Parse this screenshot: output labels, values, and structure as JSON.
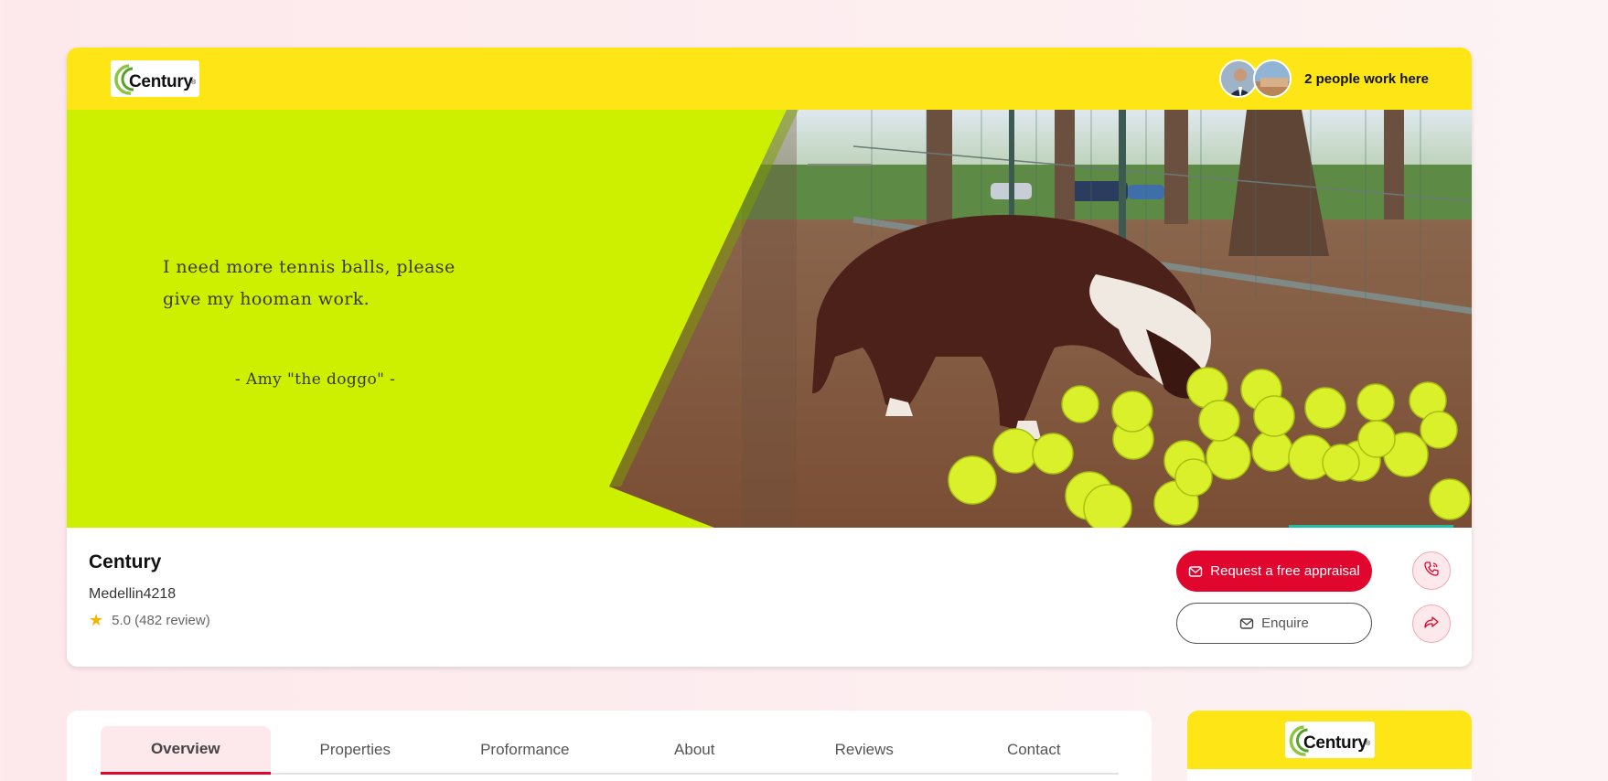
{
  "brand": {
    "name": "Century",
    "logo_text": "Century",
    "logo_reg": "®"
  },
  "header": {
    "people_text": "2 people work here"
  },
  "banner": {
    "quote": "I need more tennis balls, please give my hooman work.",
    "quote_author": "- Amy \"the doggo\" -"
  },
  "agency": {
    "name": "Century",
    "location": "Medellin4218",
    "rating": "5.0 (482 review)"
  },
  "actions": {
    "appraisal_label": "Request a free appraisal",
    "enquire_label": "Enquire"
  },
  "tabs": [
    {
      "label": "Overview",
      "active": true
    },
    {
      "label": "Properties"
    },
    {
      "label": "Proformance"
    },
    {
      "label": "About"
    },
    {
      "label": "Reviews"
    },
    {
      "label": "Contact"
    }
  ],
  "colors": {
    "header_yellow": "#fee515",
    "banner_green": "#cdef00",
    "accent_red": "#e1062d",
    "page_bg": "#fde9ec"
  },
  "icons": [
    "phone-icon",
    "share-icon",
    "mail-icon",
    "star-icon"
  ]
}
